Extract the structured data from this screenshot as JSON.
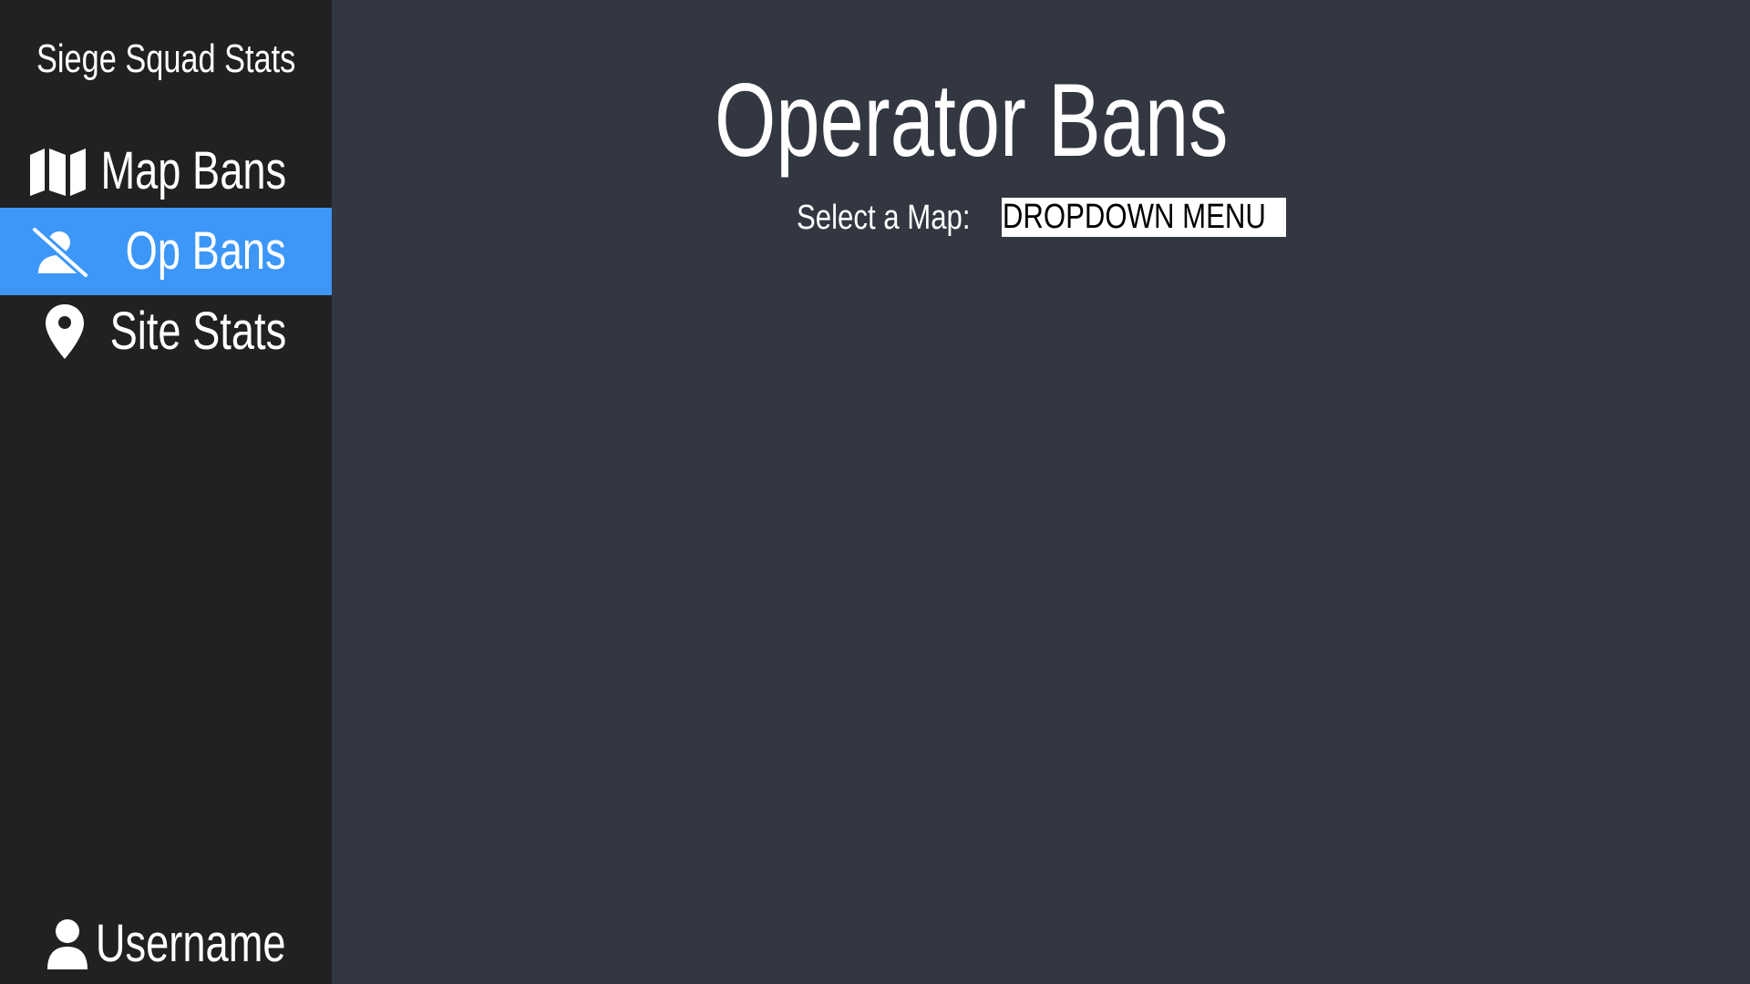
{
  "sidebar": {
    "brand": "Siege Squad Stats",
    "items": [
      {
        "label": "Map Bans",
        "icon": "map-icon"
      },
      {
        "label": "Op Bans",
        "icon": "user-slash-icon",
        "active": true
      },
      {
        "label": "Site Stats",
        "icon": "map-marker-icon"
      }
    ],
    "user": {
      "label": "Username",
      "icon": "user-icon"
    }
  },
  "main": {
    "title": "Operator Bans",
    "select_label": "Select a Map:",
    "dropdown_value": "DROPDOWN MENU"
  },
  "colors": {
    "sidebar_bg": "#212123",
    "main_bg": "#333741",
    "accent": "#3d97f8"
  }
}
